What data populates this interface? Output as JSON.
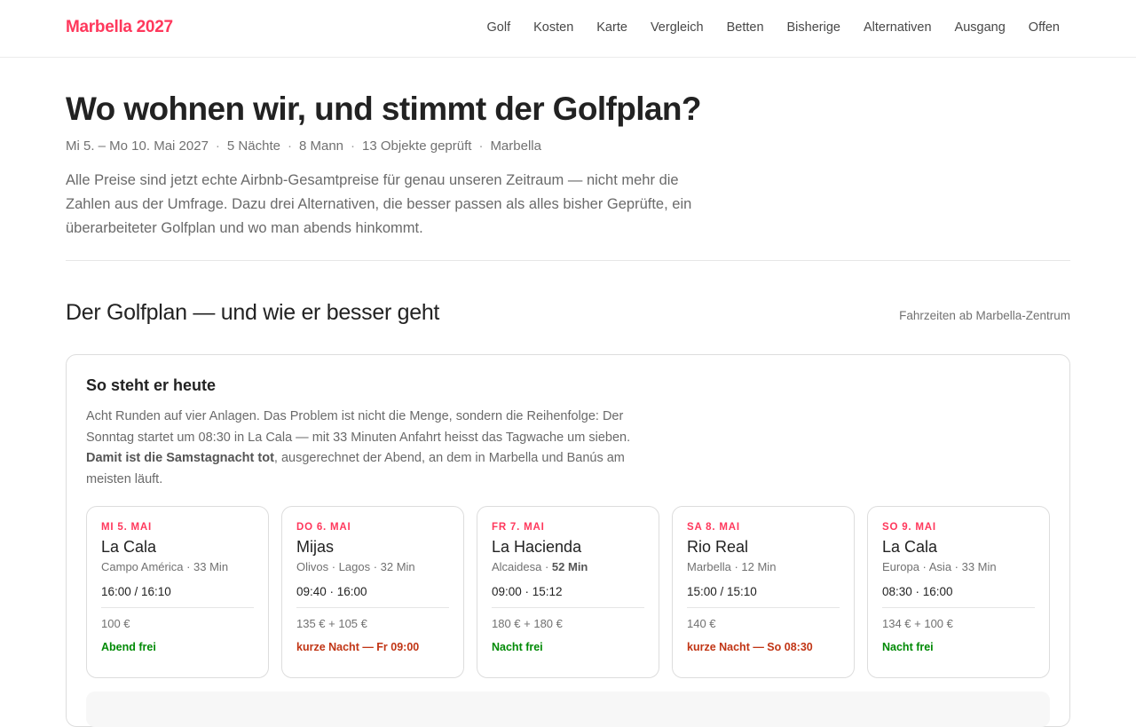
{
  "header": {
    "brand": "Marbella 2027",
    "nav": [
      "Golf",
      "Kosten",
      "Karte",
      "Vergleich",
      "Betten",
      "Bisherige",
      "Alternativen",
      "Ausgang",
      "Offen"
    ]
  },
  "hero": {
    "title": "Wo wohnen wir, und stimmt der Golfplan?",
    "meta": [
      "Mi 5. – Mo 10. Mai 2027",
      "5 Nächte",
      "8 Mann",
      "13 Objekte geprüft",
      "Marbella"
    ],
    "meta_separator": "·",
    "lead": "Alle Preise sind jetzt echte Airbnb-Gesamtpreise für genau unseren Zeitraum — nicht mehr die Zahlen aus der Umfrage. Dazu drei Alternativen, die besser passen als alles bisher Geprüfte, ein überarbeiteter Golfplan und wo man abends hinkommt."
  },
  "golf_section": {
    "title": "Der Golfplan — und wie er besser geht",
    "note": "Fahrzeiten ab Marbella-Zentrum",
    "card": {
      "title": "So steht er heute",
      "text_before": "Acht Runden auf vier Anlagen. Das Problem ist nicht die Menge, sondern die Reihenfolge: Der Sonntag startet um 08:30 in La Cala — mit 33 Minuten Anfahrt heisst das Tagwache um sieben. ",
      "text_bold": "Damit ist die Samstagnacht tot",
      "text_after": ", ausgerechnet der Abend, an dem in Marbella und Banús am meisten läuft."
    },
    "days": [
      {
        "date": "MI 5. MAI",
        "course": "La Cala",
        "sub": "Campo América · 33 Min",
        "sub_bold": "",
        "times": "16:00 / 16:10",
        "price": "100 €",
        "status": "Abend frei",
        "status_color": "#008a05"
      },
      {
        "date": "DO 6. MAI",
        "course": "Mijas",
        "sub": "Olivos · Lagos · 32 Min",
        "sub_bold": "",
        "times": "09:40 · 16:00",
        "price": "135 € + 105 €",
        "status": "kurze Nacht — Fr 09:00",
        "status_color": "#c13515"
      },
      {
        "date": "FR 7. MAI",
        "course": "La Hacienda",
        "sub": "Alcaidesa · ",
        "sub_bold": "52 Min",
        "times": "09:00 · 15:12",
        "price": "180 € + 180 €",
        "status": "Nacht frei",
        "status_color": "#008a05"
      },
      {
        "date": "SA 8. MAI",
        "course": "Rio Real",
        "sub": "Marbella · 12 Min",
        "sub_bold": "",
        "times": "15:00 / 15:10",
        "price": "140 €",
        "status": "kurze Nacht — So 08:30",
        "status_color": "#c13515"
      },
      {
        "date": "SO 9. MAI",
        "course": "La Cala",
        "sub": "Europa · Asia · 33 Min",
        "sub_bold": "",
        "times": "08:30 · 16:00",
        "price": "134 € + 100 €",
        "status": "Nacht frei",
        "status_color": "#008a05"
      }
    ]
  }
}
